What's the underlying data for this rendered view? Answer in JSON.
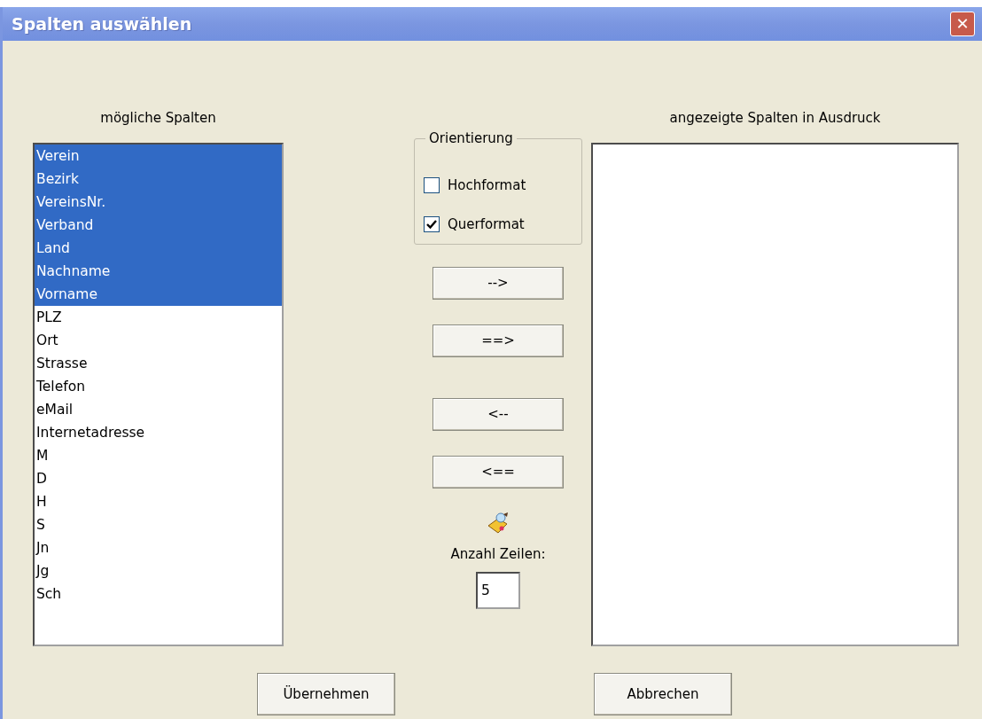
{
  "window": {
    "title": "Spalten auswählen",
    "close_label": "✕"
  },
  "available": {
    "label": "mögliche Spalten",
    "items": [
      {
        "text": "Verein",
        "selected": true
      },
      {
        "text": "Bezirk",
        "selected": true
      },
      {
        "text": "VereinsNr.",
        "selected": true
      },
      {
        "text": "Verband",
        "selected": true
      },
      {
        "text": "Land",
        "selected": true
      },
      {
        "text": "Nachname",
        "selected": true
      },
      {
        "text": "Vorname",
        "selected": true
      },
      {
        "text": "PLZ",
        "selected": false
      },
      {
        "text": "Ort",
        "selected": false
      },
      {
        "text": "Strasse",
        "selected": false
      },
      {
        "text": "Telefon",
        "selected": false
      },
      {
        "text": "eMail",
        "selected": false
      },
      {
        "text": "Internetadresse",
        "selected": false
      },
      {
        "text": "M",
        "selected": false
      },
      {
        "text": "D",
        "selected": false
      },
      {
        "text": "H",
        "selected": false
      },
      {
        "text": "S",
        "selected": false
      },
      {
        "text": "Jn",
        "selected": false
      },
      {
        "text": "Jg",
        "selected": false
      },
      {
        "text": "Sch",
        "selected": false
      }
    ]
  },
  "orientation": {
    "label": "Orientierung",
    "options": [
      {
        "label": "Hochformat",
        "checked": false
      },
      {
        "label": "Querformat",
        "checked": true
      }
    ]
  },
  "move_buttons": [
    "-->",
    "==>",
    "<--",
    "<=="
  ],
  "rows": {
    "label": "Anzahl Zeilen:",
    "value": "5"
  },
  "shown": {
    "label": "angezeigte Spalten in Ausdruck"
  },
  "buttons": [
    "Übernehmen",
    "Abbrechen"
  ]
}
